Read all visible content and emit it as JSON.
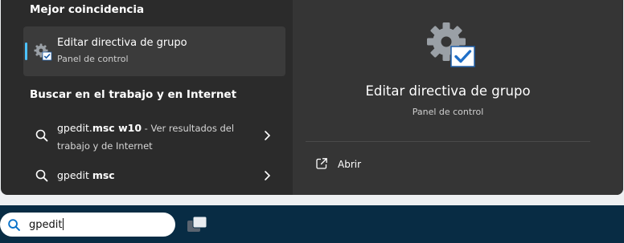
{
  "best_match": {
    "heading": "Mejor coincidencia",
    "title": "Editar directiva de grupo",
    "subtitle": "Panel de control"
  },
  "web_search": {
    "heading": "Buscar en el trabajo y en Internet",
    "items": [
      {
        "query_plain": "gpedit.",
        "query_bold": "msc w10",
        "suffix": " - Ver resultados del",
        "suffix2": "trabajo y de Internet"
      },
      {
        "query_plain": "gpedit ",
        "query_bold": "msc"
      }
    ]
  },
  "preview": {
    "title": "Editar directiva de grupo",
    "subtitle": "Panel de control",
    "open_label": "Abrir"
  },
  "taskbar": {
    "search_value": "gpedit"
  },
  "colors": {
    "panel": "#2b2b2b",
    "preview": "#353535",
    "selected": "#3b3b3b",
    "accent": "#4cc2ff",
    "taskbar": "#082c44"
  },
  "icons": {
    "app": "gear-with-checkmark-icon",
    "search": "search-icon",
    "chevron": "chevron-right-icon",
    "open": "open-external-icon",
    "task_view": "task-view-icon"
  }
}
